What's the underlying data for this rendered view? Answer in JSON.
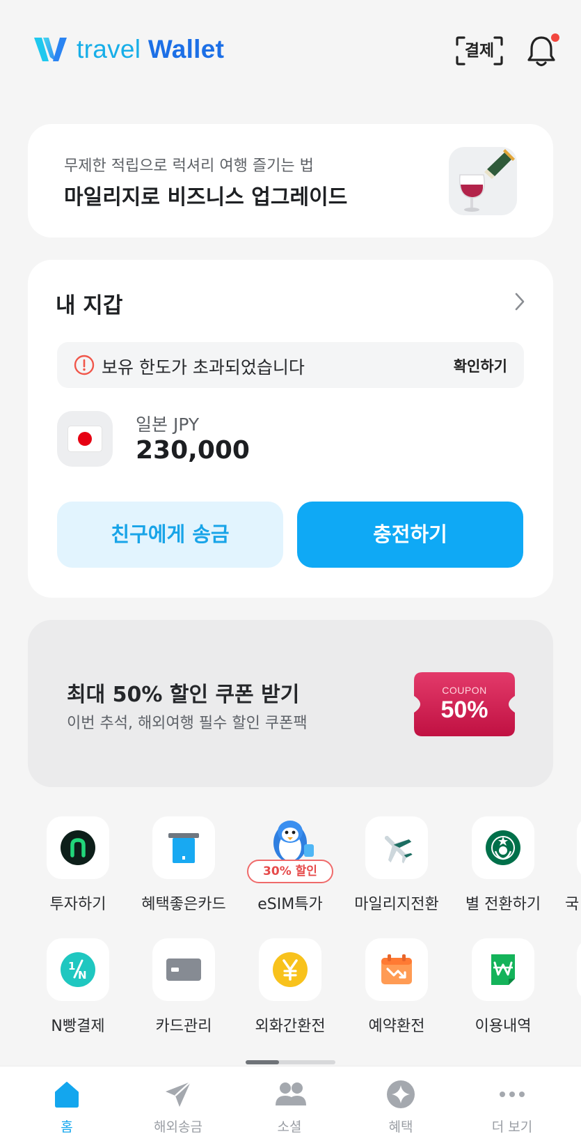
{
  "header": {
    "logo_text_light": "travel",
    "logo_text_bold": "Wallet",
    "pay_label": "결제",
    "bell_icon": "bell-icon",
    "has_notification": true
  },
  "promo": {
    "subtitle": "무제한 적립으로 럭셔리 여행 즐기는 법",
    "title": "마일리지로 비즈니스 업그레이드",
    "image_icon": "wine-glass-illustration"
  },
  "wallet": {
    "title": "내 지갑",
    "notice_text": "보유 한도가 초과되었습니다",
    "notice_action": "확인하기",
    "currency_name": "일본 JPY",
    "currency_amount": "230,000",
    "flag_icon": "japan-flag-icon",
    "send_label": "친구에게 송금",
    "charge_label": "충전하기"
  },
  "coupon": {
    "title": "최대 50% 할인 쿠폰 받기",
    "subtitle": "이번 추석, 해외여행 필수 할인 쿠폰팩",
    "ticket_small": "COUPON",
    "ticket_big": "50%"
  },
  "shortcuts_row1": [
    {
      "label": "투자하기",
      "icon": "invest-icon"
    },
    {
      "label": "혜택좋은카드",
      "icon": "card-benefit-icon"
    },
    {
      "label": "eSIM특가",
      "icon": "penguin-esim-icon",
      "badge": "30% 할인"
    },
    {
      "label": "마일리지전환",
      "icon": "airplane-icon"
    },
    {
      "label": "별 전환하기",
      "icon": "starbucks-icon"
    },
    {
      "label": "국"
    }
  ],
  "shortcuts_row2": [
    {
      "label": "N빵결제",
      "icon": "split-pay-icon"
    },
    {
      "label": "카드관리",
      "icon": "card-manage-icon"
    },
    {
      "label": "외화간환전",
      "icon": "yen-coin-icon"
    },
    {
      "label": "예약환전",
      "icon": "calendar-exchange-icon"
    },
    {
      "label": "이용내역",
      "icon": "won-receipt-icon"
    }
  ],
  "tabs": [
    {
      "label": "홈",
      "icon": "home-icon",
      "active": true
    },
    {
      "label": "해외송금",
      "icon": "send-plane-icon",
      "active": false
    },
    {
      "label": "소셜",
      "icon": "people-icon",
      "active": false
    },
    {
      "label": "혜택",
      "icon": "sparkle-icon",
      "active": false
    },
    {
      "label": "더 보기",
      "icon": "more-icon",
      "active": false
    }
  ],
  "colors": {
    "accent": "#0fa9f5",
    "accent_light": "#e2f4fe",
    "background": "#f5f5f5",
    "notification": "#f2473f",
    "coupon_red": "#d0174d"
  }
}
